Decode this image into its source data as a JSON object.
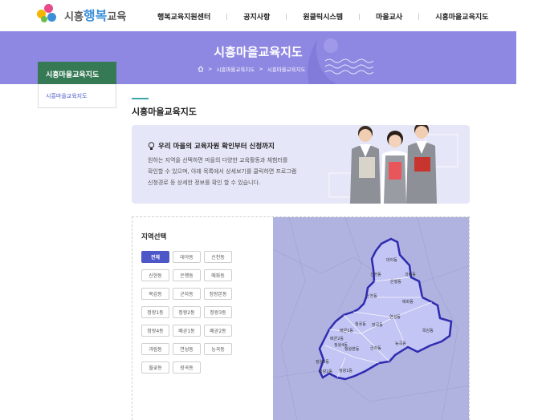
{
  "header": {
    "logo_prefix": "시흥",
    "logo_highlight": "행복",
    "logo_suffix": "교육",
    "nav": [
      "행복교육지원센터",
      "공지사항",
      "원클릭시스템",
      "마을교사",
      "시흥마을교육지도"
    ]
  },
  "banner": {
    "title": "시흥마을교육지도",
    "breadcrumb": [
      "시흥마을교육지도",
      "시흥마을교육지도"
    ]
  },
  "sidebar": {
    "heading": "시흥마을교육지도",
    "items": [
      "시흥마을교육지도"
    ]
  },
  "content": {
    "title": "시흥마을교육지도",
    "intro_heading": "우리 마을의 교육자원 확인부터 신청까지",
    "intro_lines": [
      "원하는 지역을 선택하면 마을의 다양한 교육활동과 체험터를",
      "확인할 수 있으며, 아래 목록에서 상세보기를 클릭하면 프로그램",
      "신청경로 등 상세한 정보를 확인 할 수 있습니다."
    ]
  },
  "region": {
    "label": "지역선택",
    "selected": "전체",
    "buttons": [
      "전체",
      "대야동",
      "신천동",
      "신현동",
      "은행동",
      "매화동",
      "목감동",
      "군자동",
      "정왕본동",
      "정왕1동",
      "정왕2동",
      "정왕3동",
      "정왕4동",
      "배곧1동",
      "배곧2동",
      "과림동",
      "연성동",
      "능곡동",
      "월곶동",
      "장곡동"
    ]
  },
  "map_labels": [
    "대야동",
    "과림동",
    "신현동",
    "은행동",
    "신천동",
    "매화동",
    "월곶동",
    "장곡동",
    "연성동",
    "목감동",
    "배곧1동",
    "배곧2동",
    "정왕4동",
    "정왕본동",
    "군자동",
    "능곡동",
    "정왕3동",
    "정왕2동",
    "정왕1동"
  ],
  "colors": {
    "banner": "#8f88e2",
    "sidebar_head": "#357a55",
    "accent": "#3aa6a8",
    "active_button": "#4e57c8",
    "map_region": "#c3c5f4",
    "map_border": "#2e2bb0"
  }
}
